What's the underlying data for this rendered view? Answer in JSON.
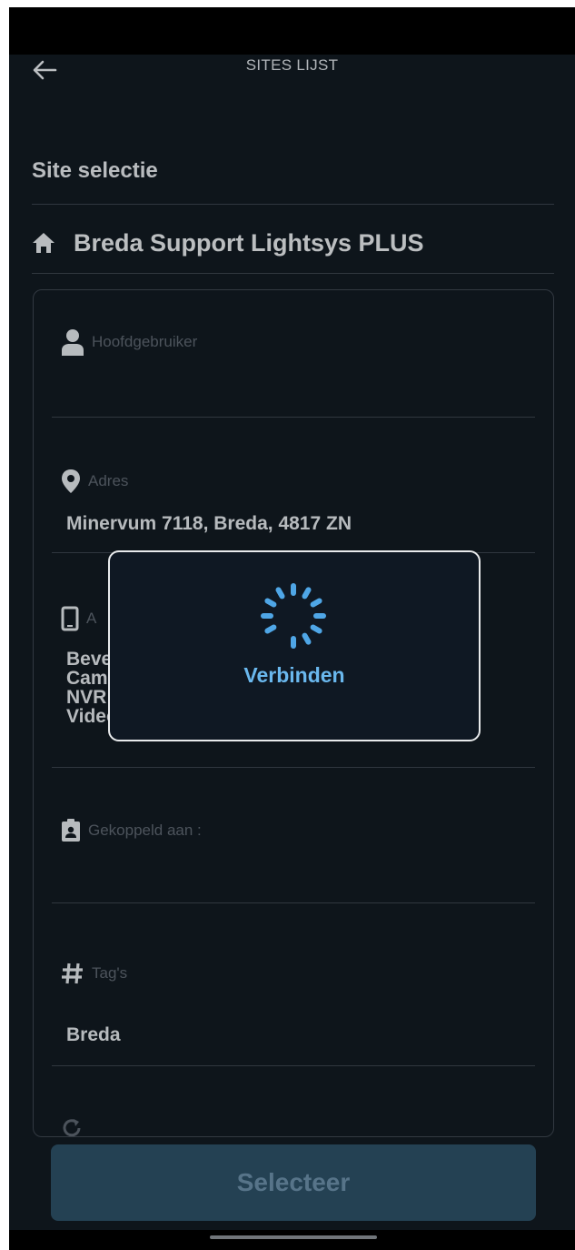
{
  "header": {
    "title": "SITES LIJST",
    "back_icon": "arrow-left-icon"
  },
  "page": {
    "title": "Site selectie"
  },
  "site": {
    "icon": "home-icon",
    "name": "Breda Support Lightsys PLUS"
  },
  "fields": {
    "main_user": {
      "label": "Hoofdgebruiker",
      "value": "",
      "icon": "person-icon"
    },
    "address": {
      "label": "Adres",
      "value": "Minervum 7118, Breda, 4817 ZN",
      "icon": "map-pin-icon"
    },
    "appliances": {
      "label": "A",
      "icon": "phone-icon",
      "lines": [
        "Beve",
        "Cam",
        "NVR",
        "Video Deurbel (0)"
      ]
    },
    "linked_to": {
      "label": "Gekoppeld aan :",
      "value": "",
      "icon": "id-badge-icon"
    },
    "tags": {
      "label": "Tag's",
      "value": "Breda",
      "icon": "hash-icon"
    },
    "next_partial": {
      "icon": "refresh-icon"
    }
  },
  "select_button": {
    "label": "Selecteer"
  },
  "loading_dialog": {
    "text": "Verbinden",
    "spinner_icon": "loading-spinner-icon"
  },
  "colors": {
    "background": "#121a22",
    "accent": "#6ab8ee",
    "button_bg": "#2d5066",
    "button_text": "#6b8ea8"
  }
}
